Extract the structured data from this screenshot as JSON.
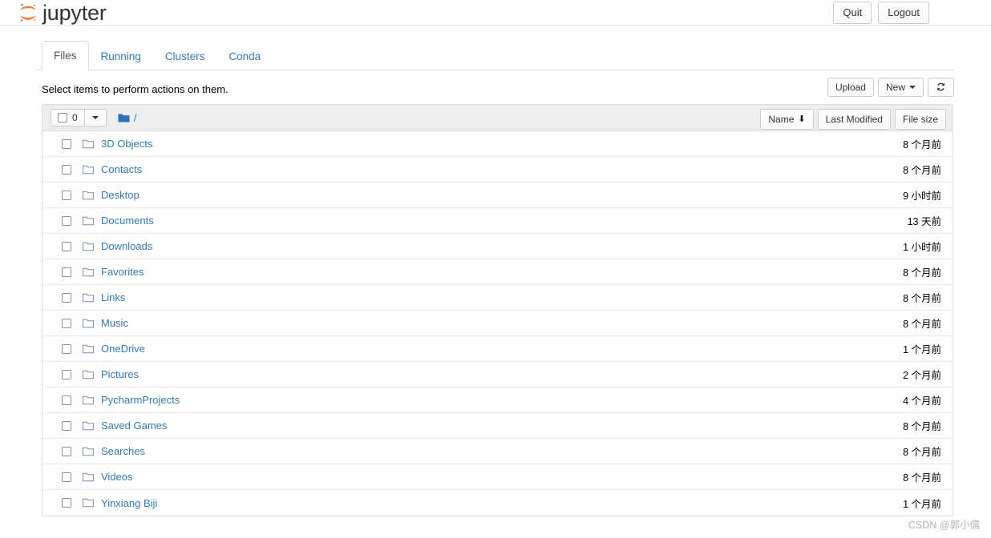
{
  "header": {
    "brand": "jupyter",
    "logo_icon": "jupyter-logo",
    "quit_label": "Quit",
    "logout_label": "Logout"
  },
  "tabs": [
    {
      "label": "Files",
      "active": true
    },
    {
      "label": "Running",
      "active": false
    },
    {
      "label": "Clusters",
      "active": false
    },
    {
      "label": "Conda",
      "active": false
    }
  ],
  "actionbar": {
    "hint": "Select items to perform actions on them.",
    "upload_label": "Upload",
    "new_label": "New",
    "refresh_icon": "refresh-icon"
  },
  "list_header": {
    "selected_count": "0",
    "select_all_checkbox": "unchecked",
    "dropdown_icon": "chevron-down-icon",
    "breadcrumb_icon": "folder-icon",
    "breadcrumb_path": "/",
    "sort_name_label": "Name",
    "sort_name_direction_icon": "arrow-down-icon",
    "sort_modified_label": "Last Modified",
    "sort_size_label": "File size"
  },
  "files": [
    {
      "name": "3D Objects",
      "icon": "folder-icon",
      "modified": "8 个月前",
      "size": ""
    },
    {
      "name": "Contacts",
      "icon": "folder-icon",
      "modified": "8 个月前",
      "size": ""
    },
    {
      "name": "Desktop",
      "icon": "folder-icon",
      "modified": "9 小时前",
      "size": ""
    },
    {
      "name": "Documents",
      "icon": "folder-icon",
      "modified": "13 天前",
      "size": ""
    },
    {
      "name": "Downloads",
      "icon": "folder-icon",
      "modified": "1 小时前",
      "size": ""
    },
    {
      "name": "Favorites",
      "icon": "folder-icon",
      "modified": "8 个月前",
      "size": ""
    },
    {
      "name": "Links",
      "icon": "folder-icon",
      "modified": "8 个月前",
      "size": ""
    },
    {
      "name": "Music",
      "icon": "folder-icon",
      "modified": "8 个月前",
      "size": ""
    },
    {
      "name": "OneDrive",
      "icon": "folder-icon",
      "modified": "1 个月前",
      "size": ""
    },
    {
      "name": "Pictures",
      "icon": "folder-icon",
      "modified": "2 个月前",
      "size": ""
    },
    {
      "name": "PycharmProjects",
      "icon": "folder-icon",
      "modified": "4 个月前",
      "size": ""
    },
    {
      "name": "Saved Games",
      "icon": "folder-icon",
      "modified": "8 个月前",
      "size": ""
    },
    {
      "name": "Searches",
      "icon": "folder-icon",
      "modified": "8 个月前",
      "size": ""
    },
    {
      "name": "Videos",
      "icon": "folder-icon",
      "modified": "8 个月前",
      "size": ""
    },
    {
      "name": "Yinxiang Biji",
      "icon": "folder-icon",
      "modified": "1 个月前",
      "size": ""
    }
  ],
  "watermark": "CSDN @郭小儒",
  "colors": {
    "link": "#337ab7",
    "brand_orange": "#f37726",
    "header_bg": "#eeeeee",
    "border": "#dddddd",
    "folder_solid": "#2a73b8"
  }
}
